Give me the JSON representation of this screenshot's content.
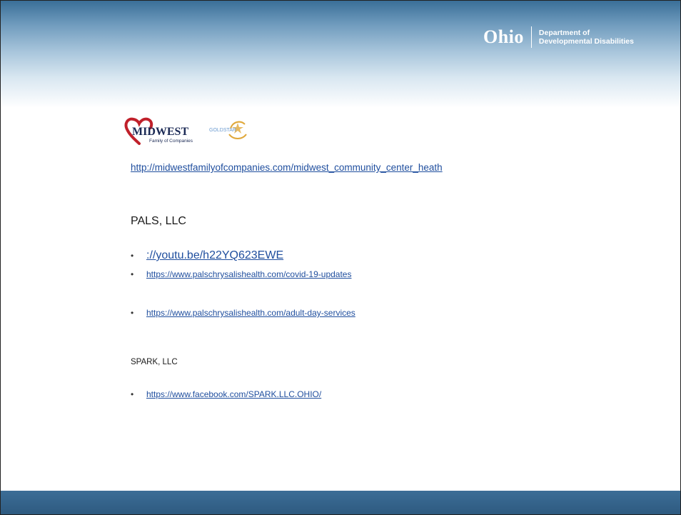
{
  "header": {
    "ohio_word": "Ohio",
    "dept_line1": "Department of",
    "dept_line2": "Developmental Disabilities"
  },
  "logos": {
    "midwest_name": "MIDWEST",
    "midwest_sub": "Family of Companies",
    "goldstar_name": "GOLDSTAR"
  },
  "midwest_link": "http://midwestfamilyofcompanies.com/midwest_community_center_heath",
  "pals": {
    "heading": "PALS, LLC",
    "links": [
      "://youtu.be/h22YQ623EWE",
      "https://www.palschrysalishealth.com/covid-19-updates",
      "https://www.palschrysalishealth.com/adult-day-services"
    ]
  },
  "spark": {
    "heading": "SPARK, LLC",
    "links": [
      "https://www.facebook.com/SPARK.LLC.OHIO/"
    ]
  },
  "colors": {
    "link": "#1f4e9e",
    "header_top": "#3a6f98",
    "footer": "#2e5a80",
    "midwest_red": "#c0202a",
    "midwest_navy": "#1b2a55",
    "goldstar_gold": "#e0a83a",
    "goldstar_blue": "#6a9ad0"
  },
  "bullet": "•"
}
